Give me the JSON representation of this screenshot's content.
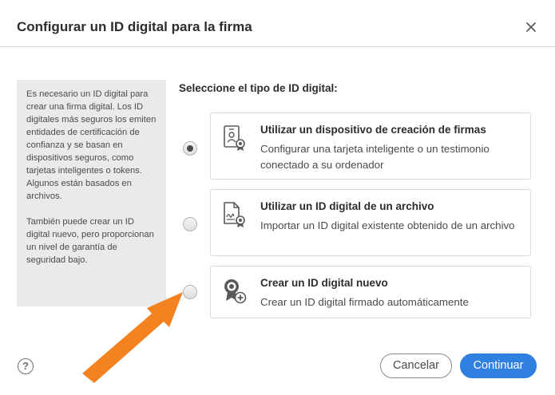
{
  "dialog": {
    "title": "Configurar un ID digital para la firma",
    "close_icon": "close-icon"
  },
  "info": {
    "paragraph1": "Es necesario un ID digital para crear una firma digital. Los ID digitales más seguros los emiten entidades de certificación de confianza y se basan en dispositivos seguros, como tarjetas inteligentes o tokens. Algunos están basados en archivos.",
    "paragraph2": "También puede crear un ID digital nuevo, pero proporcionan un nivel de garantía de seguridad bajo."
  },
  "selection": {
    "heading": "Seleccione el tipo de ID digital:",
    "selected_option": "device",
    "options": [
      {
        "id": "device",
        "icon": "certificate-card-icon",
        "title": "Utilizar un dispositivo de creación de firmas",
        "description": "Configurar una tarjeta inteligente o un testimonio conectado a su ordenador",
        "selected": true
      },
      {
        "id": "file",
        "icon": "signature-file-icon",
        "title": "Utilizar un ID digital de un archivo",
        "description": "Importar un ID digital existente obtenido de un archivo",
        "selected": false
      },
      {
        "id": "new",
        "icon": "new-badge-icon",
        "title": "Crear un ID digital nuevo",
        "description": "Crear un ID digital firmado automáticamente",
        "selected": false
      }
    ]
  },
  "footer": {
    "help_label": "?",
    "cancel_label": "Cancelar",
    "continue_label": "Continuar"
  },
  "colors": {
    "primary_button": "#2f80e0",
    "annotation_arrow": "#f58220"
  }
}
